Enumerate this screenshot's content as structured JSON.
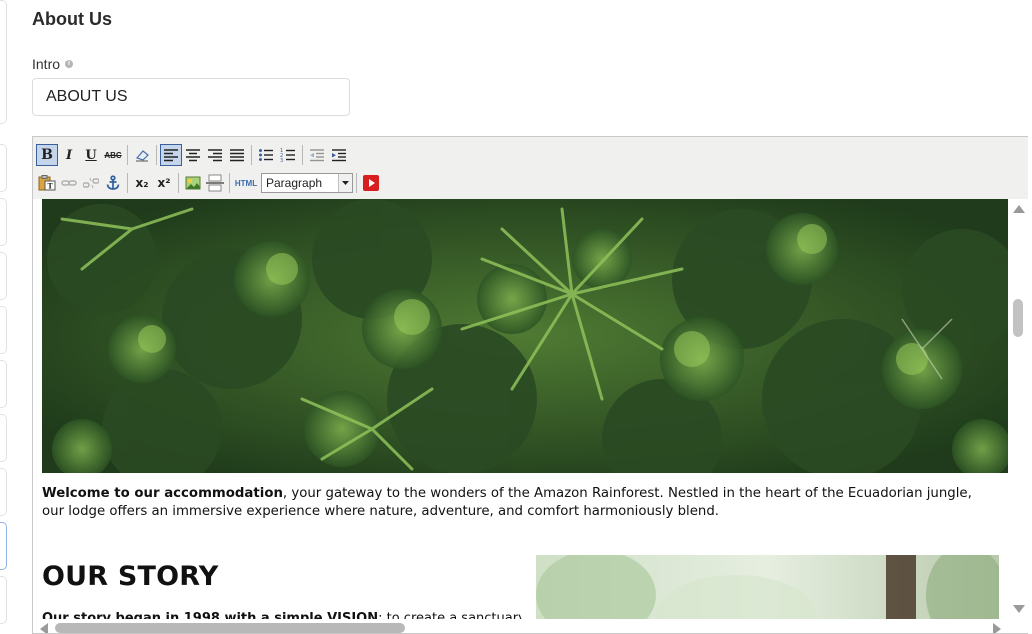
{
  "section": {
    "title": "About Us"
  },
  "intro": {
    "label": "Intro",
    "info_icon": "info-icon",
    "value": "ABOUT US"
  },
  "toolbar": {
    "row1": [
      {
        "name": "bold",
        "glyph": "B",
        "active": true
      },
      {
        "name": "italic",
        "glyph": "I"
      },
      {
        "name": "underline",
        "glyph": "U"
      },
      {
        "name": "strikethrough",
        "glyph": "ABC"
      },
      {
        "name": "remove-format"
      },
      {
        "name": "align-left",
        "active": true
      },
      {
        "name": "align-center"
      },
      {
        "name": "align-right"
      },
      {
        "name": "align-justify"
      },
      {
        "name": "bullet-list"
      },
      {
        "name": "numbered-list"
      },
      {
        "name": "outdent"
      },
      {
        "name": "indent"
      }
    ],
    "row2": [
      {
        "name": "paste-text"
      },
      {
        "name": "link"
      },
      {
        "name": "unlink"
      },
      {
        "name": "anchor"
      },
      {
        "name": "subscript",
        "glyph": "x₂"
      },
      {
        "name": "superscript",
        "glyph": "x²"
      },
      {
        "name": "insert-image"
      },
      {
        "name": "horizontal-rule"
      },
      {
        "name": "html-source",
        "glyph": "HTML"
      }
    ],
    "format_select": {
      "value": "Paragraph"
    },
    "media_button": "youtube-icon"
  },
  "content": {
    "welcome_bold": "Welcome to our accommodation",
    "welcome_rest": ", your gateway to the wonders of the Amazon Rainforest. Nestled in the heart of the Ecuadorian jungle, our lodge offers an immersive experience where nature, adventure, and comfort harmoniously blend.",
    "story_heading": "OUR STORY",
    "story_text_bold": "Our story began in 1998 with a simple VISION",
    "story_text_rest": ": to create a sanctuary where"
  },
  "colors": {
    "accent": "#3a5f9b",
    "toolbar_bg": "#f0f0ee",
    "jungle_dark": "#1e3a1c",
    "jungle_light": "#6fa24a"
  }
}
